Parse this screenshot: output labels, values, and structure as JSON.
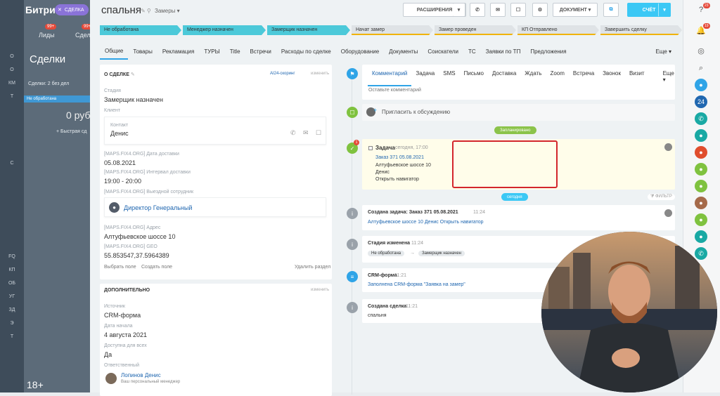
{
  "left_rail": {
    "items": [
      "",
      "",
      "О",
      "О",
      "КМ",
      "Т",
      "",
      "",
      "",
      "",
      "С",
      "",
      "",
      "",
      "",
      "",
      "",
      "FQ",
      "КП",
      "ОБ",
      "УГ",
      "ЗД",
      "Э",
      "Т",
      "",
      ""
    ]
  },
  "bg": {
    "brand": "Битри",
    "deal_button": "СДЕЛКА",
    "tab_leads": "Лиды",
    "tab_deals": "Сделки",
    "lead_badge": "99+",
    "deal_badge": "99+",
    "page_title": "Сделки",
    "filter_text": "Сделки: 2  без дел",
    "stage": "Не обработана",
    "amount": "0 руб",
    "quick_add": "+ Быстрая сд",
    "age": "18+"
  },
  "header": {
    "title": "спальня",
    "pipeline": "Замеры",
    "btn_extensions": "РАСШИРЕНИЯ",
    "btn_document": "ДОКУМЕНТ",
    "btn_invoice": "СЧЁТ"
  },
  "stages": [
    {
      "label": "Не обработана",
      "active": true,
      "w": 116
    },
    {
      "label": "Менеджер назначен",
      "active": true,
      "w": 118
    },
    {
      "label": "Замерщик назначен",
      "active": true,
      "w": 118
    },
    {
      "label": "Начат замер",
      "active": false,
      "w": 116
    },
    {
      "label": "Замер проведен",
      "active": false,
      "w": 116
    },
    {
      "label": "КП Отправлено",
      "active": false,
      "w": 116
    },
    {
      "label": "Завершить сделку",
      "active": false,
      "w": 116
    }
  ],
  "tabs": [
    "Общие",
    "Товары",
    "Рекламация",
    "ТУРЫ",
    "Title",
    "Встречи",
    "Расходы по сделке",
    "Оборудование",
    "Документы",
    "Соискатели",
    "ТС",
    "Заявки по ТП",
    "Предложения",
    "Еще"
  ],
  "about": {
    "heading": "О СДЕЛКЕ",
    "scoring": "AI24-скоринг",
    "change": "изменить",
    "stage_label": "Стадия",
    "stage_value": "Замерщик назначен",
    "client_label": "Клиент",
    "contact_label": "Контакт",
    "contact_name": "Денис",
    "delivery_date_label": "[MAPS.FIX4.ORG] Дата доставки",
    "delivery_date": "05.08.2021",
    "interval_label": "[MAPS.FIX4.ORG] Интервал доставки",
    "interval": "19:00 - 20:00",
    "employee_label": "[MAPS.FIX4.ORG] Выездной сотрудник",
    "employee": "Директор Генеральный",
    "address_label": "[MAPS.FIX4.ORG] Адрес",
    "address": "Алтуфьевское шоссе 10",
    "geo_label": "[MAPS.FIX4.ORG] GEO",
    "geo": "55.853547,37.5964389",
    "select_field": "Выбрать поле",
    "create_field": "Создать поле",
    "delete_section": "Удалить раздел"
  },
  "extra": {
    "heading": "ДОПОЛНИТЕЛЬНО",
    "change": "изменить",
    "source_label": "Источник",
    "source": "CRM-форма",
    "start_label": "Дата начала",
    "start": "4 августа 2021",
    "access_label": "Доступна для всех",
    "access": "Да",
    "resp_label": "Ответственный",
    "resp_name": "Лопинов Денис",
    "resp_role": "Ваш персональный менеджер"
  },
  "comment": {
    "tabs": [
      "Комментарий",
      "Задача",
      "SMS",
      "Письмо",
      "Доставка",
      "Ждать",
      "Zoom",
      "Встреча",
      "Звонок",
      "Визит",
      "Еще"
    ],
    "placeholder": "Оставьте комментарий",
    "invite": "Пригласить к обсуждению"
  },
  "timeline": {
    "planned": "Запланировано",
    "today": "сегодня",
    "filter": "ФИЛЬТР",
    "task": {
      "title": "Задача",
      "time": "сегодня, 17:00",
      "order": "Заказ 371 05.08.2021",
      "address": "Алтуфьевское шоссе 10",
      "name": "Денис",
      "nav": "Открыть навигатор",
      "badge": "1"
    },
    "ev1": {
      "title": "Создана задача: Заказ 371 05.08.2021",
      "time": "11:24",
      "body": "Алтуфьевское шоссе 10 Денис Открыть навигатор"
    },
    "ev2": {
      "title": "Стадия изменена",
      "time": "11:24",
      "from": "Не обработана",
      "to": "Замерщик назначен"
    },
    "ev3": {
      "title": "CRM-форма",
      "time": "11:21",
      "body": "Заполнена CRM-форма \"Заявка на замер\""
    },
    "ev4": {
      "title": "Создана сделка",
      "time": "11:21",
      "body": "спальня"
    }
  },
  "right_bar": {
    "badge_top": "23",
    "badge_bell": "19",
    "n24": "24"
  },
  "colors": {
    "accent": "#3bc8f5",
    "stage_active": "#4cc9d9",
    "highlight": "#d3262c",
    "task_bg": "#fffdea"
  }
}
